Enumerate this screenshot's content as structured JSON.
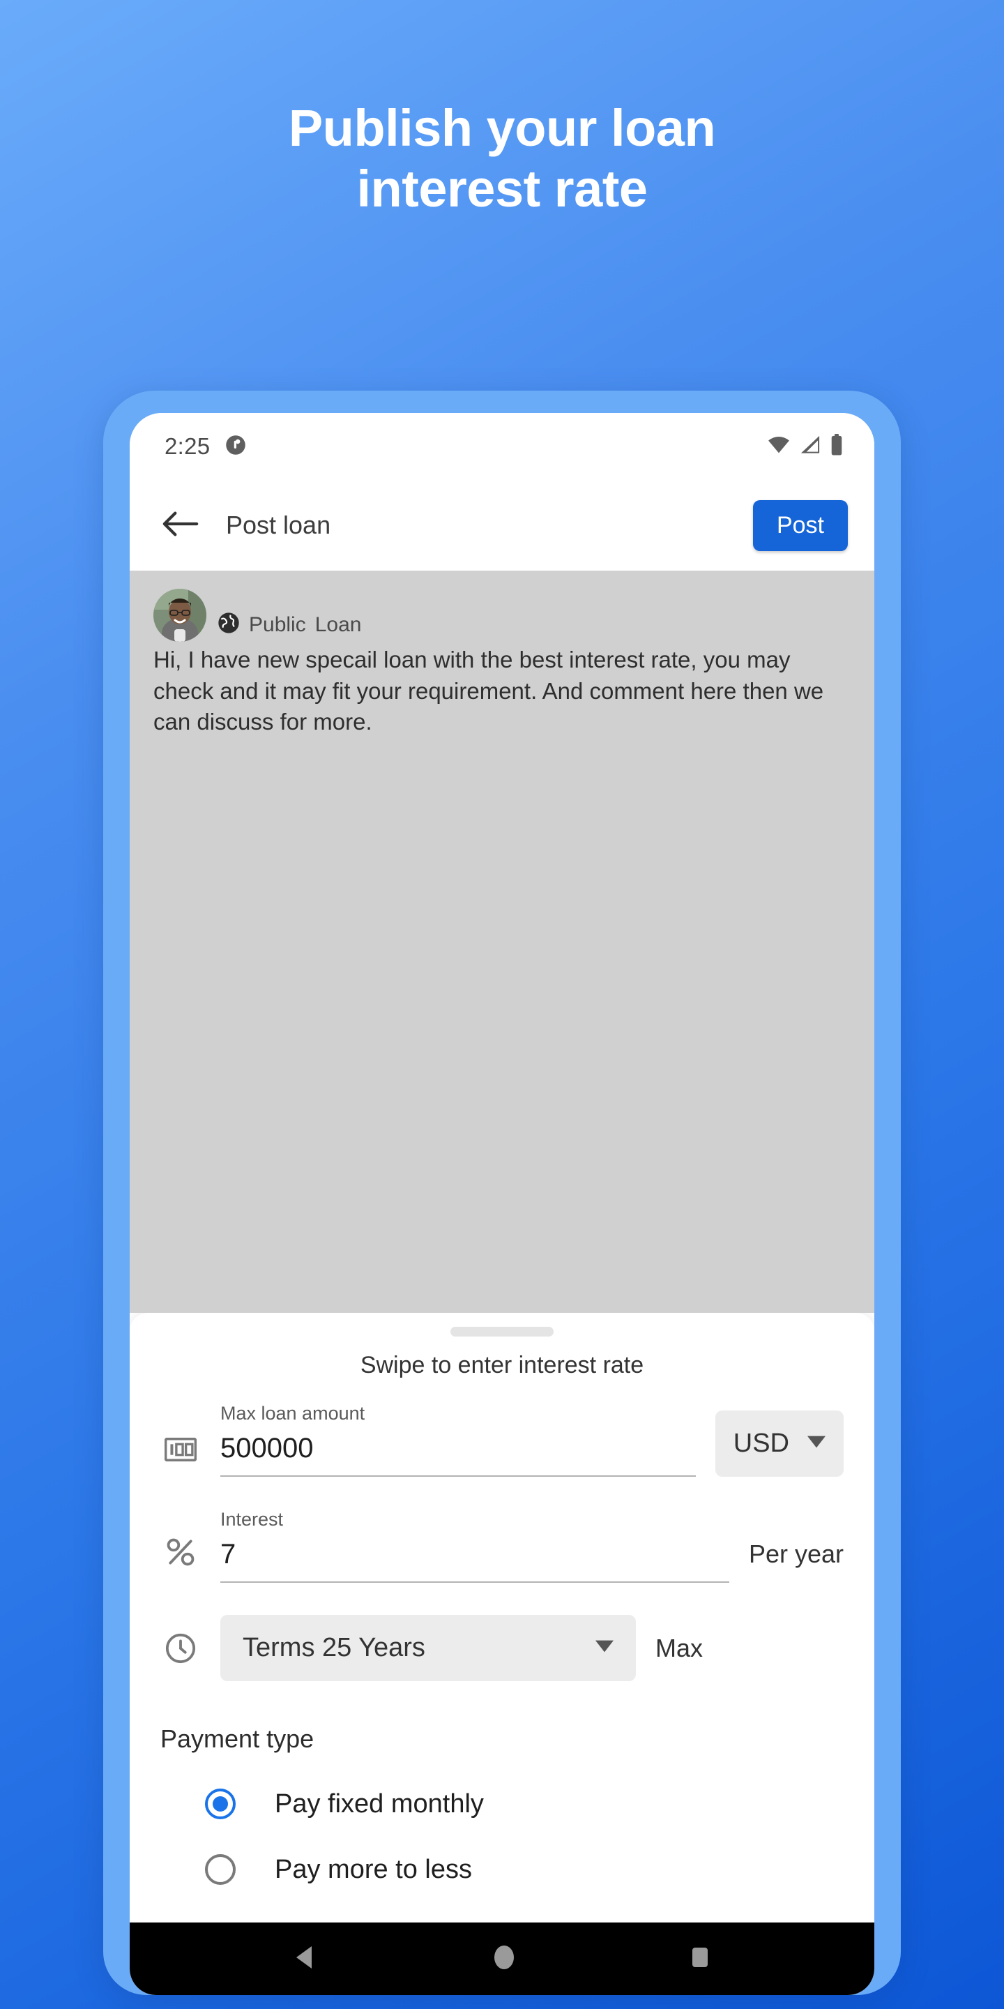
{
  "hero": {
    "title": "Publish your loan\ninterest rate"
  },
  "colors": {
    "background_top": "#6aabfa",
    "background_bottom": "#0d57d6",
    "phone_frame": "#6aabf7",
    "accent": "#1565d8",
    "radio_selected": "#1a73e8",
    "composer_background": "#d0d0d0"
  },
  "status_bar": {
    "time": "2:25",
    "icons": [
      "notification-dot-icon",
      "wifi-icon",
      "cellular-signal-icon",
      "battery-icon"
    ]
  },
  "toolbar": {
    "back_icon": "arrow-left-icon",
    "title": "Post loan",
    "post_label": "Post"
  },
  "composer": {
    "avatar_name": "user-avatar",
    "audience_icon": "globe-icon",
    "audience_label": "Public",
    "category_label": "Loan",
    "body_text": "Hi, I have new specail loan with the best interest rate, you may check and it may fit your requirement. And comment here then we can discuss for more."
  },
  "sheet": {
    "title": "Swipe to enter interest rate",
    "fields": {
      "amount": {
        "icon": "banknote-icon",
        "label": "Max loan amount",
        "value": "500000",
        "currency": "USD",
        "currency_caret": "caret-down-icon"
      },
      "interest": {
        "icon": "percent-icon",
        "label": "Interest",
        "value": "7",
        "suffix": "Per year"
      },
      "terms": {
        "icon": "clock-icon",
        "value": "Terms 25 Years",
        "caret": "caret-down-icon",
        "suffix": "Max"
      }
    },
    "payment_type": {
      "title": "Payment type",
      "options": [
        {
          "label": "Pay fixed monthly",
          "selected": true
        },
        {
          "label": "Pay more to less",
          "selected": false
        }
      ]
    }
  },
  "nav_bar": {
    "back": "nav-back-triangle-icon",
    "home": "nav-home-circle-icon",
    "recents": "nav-recents-square-icon"
  }
}
